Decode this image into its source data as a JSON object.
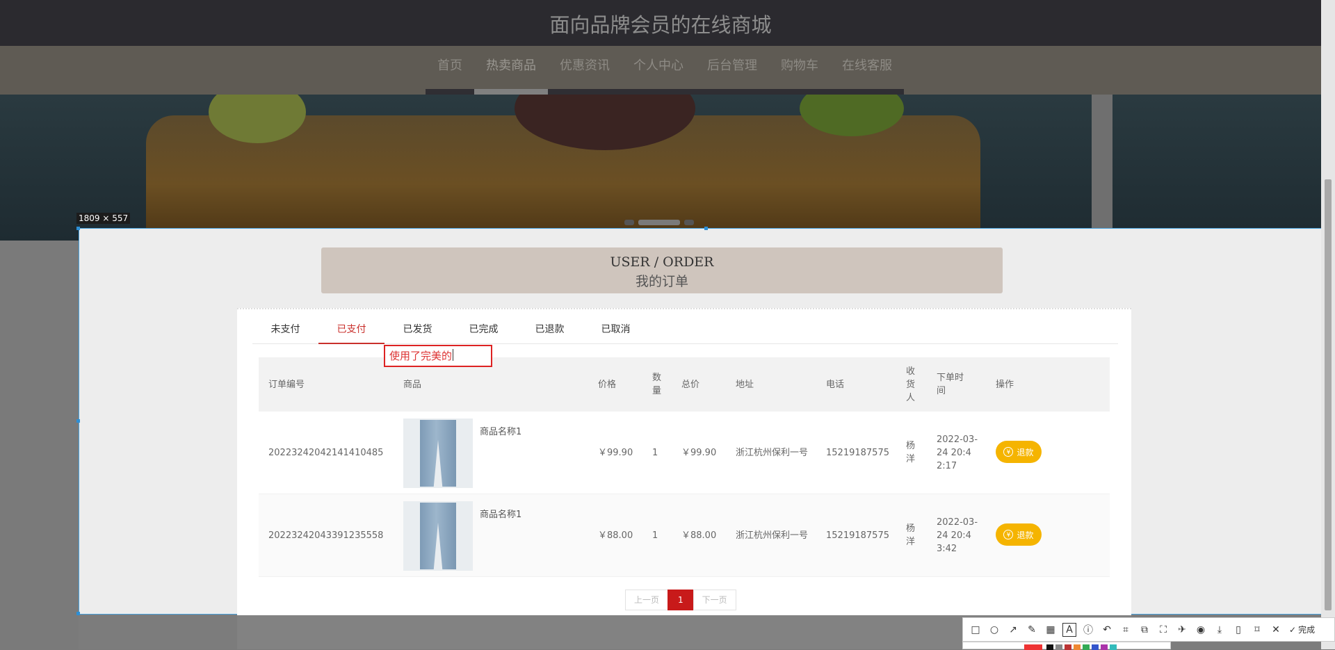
{
  "site": {
    "title": "面向品牌会员的在线商城"
  },
  "nav": {
    "items": [
      {
        "label": "首页"
      },
      {
        "label": "热卖商品"
      },
      {
        "label": "优惠资讯"
      },
      {
        "label": "个人中心"
      },
      {
        "label": "后台管理"
      },
      {
        "label": "购物车"
      },
      {
        "label": "在线客服"
      }
    ],
    "active_index": 1
  },
  "selection": {
    "size_label": "1809 × 557"
  },
  "page": {
    "title_en": "USER / ORDER",
    "title_cn": "我的订单"
  },
  "tabs": {
    "items": [
      {
        "label": "未支付"
      },
      {
        "label": "已支付"
      },
      {
        "label": "已发货"
      },
      {
        "label": "已完成"
      },
      {
        "label": "已退款"
      },
      {
        "label": "已取消"
      }
    ],
    "active_index": 1
  },
  "annotation": {
    "text": "使用了完美的"
  },
  "table": {
    "headers": {
      "order_no": "订单编号",
      "product": "商品",
      "price": "价格",
      "qty": "数量",
      "total": "总价",
      "address": "地址",
      "phone": "电话",
      "receiver": "收货人",
      "time": "下单时间",
      "action": "操作"
    },
    "rows": [
      {
        "order_no": "20223242042141410485",
        "product_name": "商品名称1",
        "price": "￥99.90",
        "qty": "1",
        "total": "￥99.90",
        "address": "浙江杭州保利一号",
        "phone": "15219187575",
        "receiver": "杨洋",
        "time": "2022-03-24 20:42:17",
        "action": "退款"
      },
      {
        "order_no": "20223242043391235558",
        "product_name": "商品名称1",
        "price": "￥88.00",
        "qty": "1",
        "total": "￥88.00",
        "address": "浙江杭州保利一号",
        "phone": "15219187575",
        "receiver": "杨洋",
        "time": "2022-03-24 20:43:42",
        "action": "退款"
      }
    ]
  },
  "pagination": {
    "prev": "上一页",
    "current": "1",
    "next": "下一页"
  },
  "toolbar": {
    "done_label": "完成"
  },
  "colors": {
    "accent": "#c81a1a",
    "refund_button": "#f5b400",
    "selection_border": "#49a4e0"
  }
}
